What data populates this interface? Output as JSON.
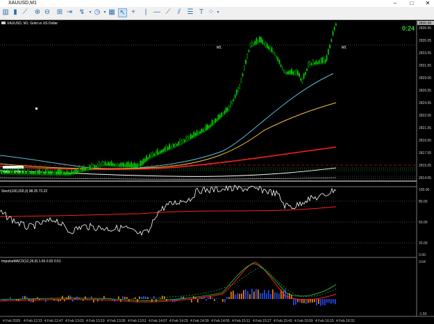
{
  "window": {
    "title": "XAUUSD,M1"
  },
  "toolbar": {
    "icons": [
      "bars-icon",
      "candles-icon",
      "line-chart-icon",
      "zoom-in-icon",
      "zoom-out-icon",
      "grid-icon",
      "autoscroll-icon",
      "shift-icon",
      "indicators-icon",
      "periods-icon",
      "templates-icon",
      "cursor-icon",
      "crosshair-icon",
      "vertical-line-icon",
      "horizontal-line-icon",
      "trendline-icon",
      "channel-icon",
      "fibonacci-icon",
      "text-icon",
      "shapes-icon"
    ]
  },
  "main_chart": {
    "label": "XAUUSD, M1: Gold vs US Dollar",
    "countdown": "0:24",
    "current_price": "2830.58",
    "price_ticks": [
      "2836.55",
      "2835.05",
      "2833.55",
      "2831.55",
      "2829.00",
      "2826.55",
      "2824.55",
      "2822.05",
      "2821.05",
      "2819.50",
      "2817.55",
      "2815.05",
      "2814.05"
    ],
    "markers": [
      "M1",
      "M1"
    ],
    "colors": {
      "up": "#00c800",
      "ma_fast": "#5bc0de",
      "ma_mid": "#f5c242",
      "ma_slow": "#ff2020",
      "ma_long": "#ffffff",
      "dashed": "#ff0000"
    }
  },
  "stoch": {
    "label": "Stoch(100,200,3) 98.25 73.22",
    "levels": [
      "100.00",
      "80.00",
      "50.00",
      "20.00",
      "0.00"
    ]
  },
  "macd": {
    "label": "ImpulseMACD(12,26,9) 1.65 0.92 0.51",
    "levels": [
      "3.64",
      "-1.50"
    ]
  },
  "time_axis": [
    "4 Feb 2025",
    "4 Feb 12:23",
    "4 Feb 12:47",
    "4 Feb 13:03",
    "4 Feb 13:19",
    "4 Feb 13:35",
    "4 Feb 13:51",
    "4 Feb 14:07",
    "4 Feb 14:23",
    "4 Feb 14:39",
    "4 Feb 14:55",
    "4 Feb 15:11",
    "4 Feb 15:27",
    "4 Feb 15:43",
    "4 Feb 15:59",
    "4 Feb 16:15",
    "4 Feb 16:31"
  ]
}
